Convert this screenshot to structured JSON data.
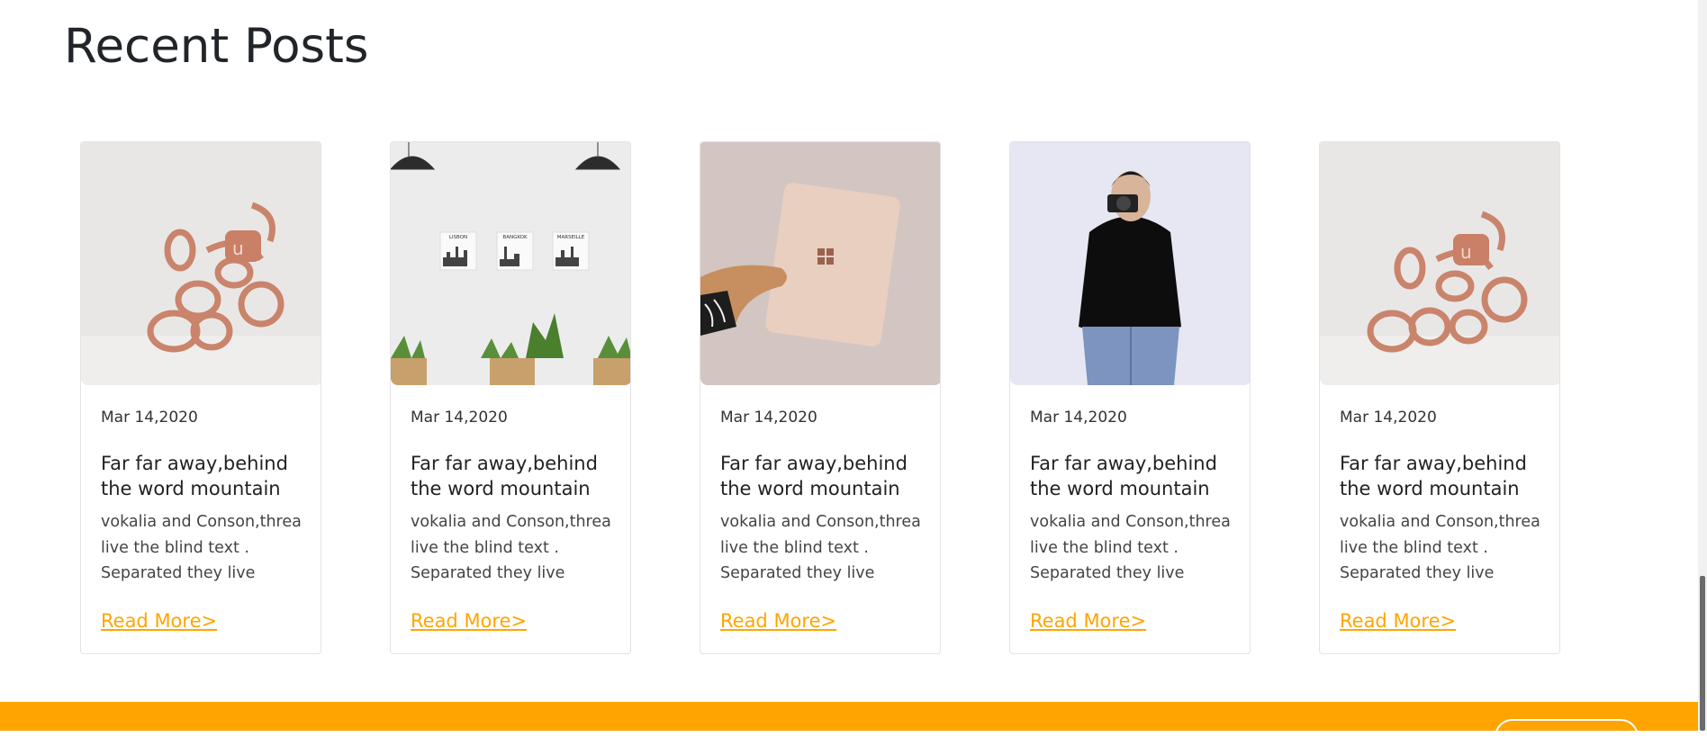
{
  "section": {
    "heading": "Recent Posts"
  },
  "posts": [
    {
      "date": "Mar 14,2020",
      "title": "Far far away,behind the word mountain",
      "excerpt": "vokalia and Conson,threa live the blind text . Separated they live",
      "read_more": "Read More>"
    },
    {
      "date": "Mar 14,2020",
      "title": "Far far away,behind the word mountain",
      "excerpt": "vokalia and Conson,threa live the blind text . Separated they live",
      "read_more": "Read More>"
    },
    {
      "date": "Mar 14,2020",
      "title": "Far far away,behind the word mountain",
      "excerpt": "vokalia and Conson,threa live the blind text . Separated they live",
      "read_more": "Read More>"
    },
    {
      "date": "Mar 14,2020",
      "title": "Far far away,behind the word mountain",
      "excerpt": "vokalia and Conson,threa live the blind text . Separated they live",
      "read_more": "Read More>"
    },
    {
      "date": "Mar 14,2020",
      "title": "Far far away,behind the word mountain",
      "excerpt": "vokalia and Conson,threa live the blind text . Separated they live",
      "read_more": "Read More>"
    }
  ],
  "images": {
    "wall_posters": [
      "LISBON",
      "BANGKOK",
      "MARSEILLE"
    ]
  },
  "colors": {
    "accent": "#ffa500",
    "footer": "#ffa400",
    "text": "#212529"
  }
}
